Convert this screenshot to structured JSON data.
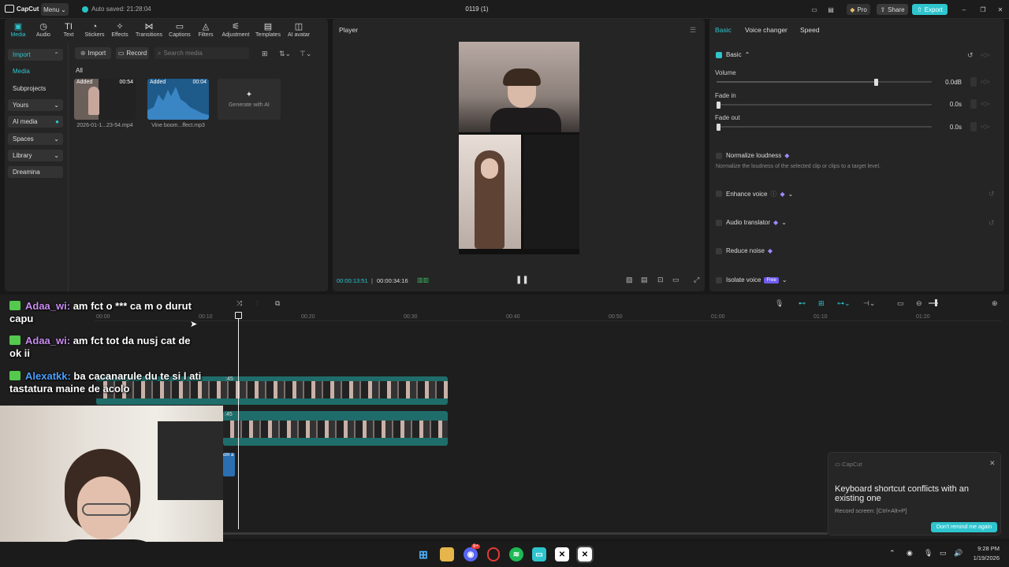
{
  "titlebar": {
    "app_name": "CapCut",
    "menu_label": "Menu",
    "autosave": "Auto saved: 21:28:04",
    "project_title": "0119 (1)",
    "pro_label": "Pro",
    "share_label": "Share",
    "export_label": "Export"
  },
  "toolbar": {
    "tabs": [
      "Media",
      "Audio",
      "Text",
      "Stickers",
      "Effects",
      "Transitions",
      "Captions",
      "Filters",
      "Adjustment",
      "Templates",
      "AI avatar"
    ]
  },
  "media": {
    "left_nav": [
      "Import",
      "Media",
      "Subprojects",
      "Yours",
      "AI media",
      "Spaces",
      "Library",
      "Dreamina"
    ],
    "import_btn": "Import",
    "record_btn": "Record",
    "search_placeholder": "Search media",
    "filter_all": "All",
    "items": [
      {
        "tag": "Added",
        "duration": "00:54",
        "name": "2026-01-1...23-54.mp4"
      },
      {
        "tag": "Added",
        "duration": "00:04",
        "name": "Vine boom...ffect.mp3"
      }
    ],
    "generate_label": "Generate with AI"
  },
  "player": {
    "title": "Player",
    "current_time": "00:00:13:51",
    "total_time": "00:00:34:16"
  },
  "props": {
    "tabs": [
      "Basic",
      "Voice changer",
      "Speed"
    ],
    "basic_header": "Basic",
    "volume_label": "Volume",
    "volume_value": "0.0dB",
    "volume_level": 0.74,
    "fadein_label": "Fade in",
    "fadein_value": "0.0s",
    "fadeout_label": "Fade out",
    "fadeout_value": "0.0s",
    "normalize_label": "Normalize loudness",
    "normalize_desc": "Normalize the loudness of the selected clip or clips to a target level.",
    "enhance_label": "Enhance voice",
    "translator_label": "Audio translator",
    "reduce_label": "Reduce noise",
    "isolate_label": "Isolate voice",
    "free_badge": "Free"
  },
  "timeline": {
    "ticks": [
      "00:00",
      "00:10",
      "00:20",
      "00:30",
      "00:40",
      "00:50",
      "01:00",
      "01:10",
      "01:20"
    ],
    "clip1_label": ":45",
    "clip2_label": ":45",
    "audio_label": "om a"
  },
  "chat": [
    {
      "name": "Adaa_wi:",
      "text": " am fct o *** ca m o durut",
      "wrap": "capu"
    },
    {
      "name": "Adaa_wi:",
      "text": " am fct tot da nusj cat de",
      "wrap": "ok ii"
    },
    {
      "name": "Alexatkk:",
      "text": " ba cacanarule du te si l ati",
      "wrap": "tastatura maine de acolo"
    }
  ],
  "notification": {
    "app": "CapCut",
    "message": "Keyboard shortcut conflicts with an existing one",
    "detail": "Record screen: [Ctrl+Alt+P]",
    "button": "Don't remind me again"
  },
  "taskbar": {
    "time": "9:28 PM",
    "date": "1/19/2026",
    "notif_count": "9+"
  },
  "colors": {
    "accent": "#2ec5ce",
    "clip": "#1f6d6a",
    "gem": "#9c8bff"
  }
}
